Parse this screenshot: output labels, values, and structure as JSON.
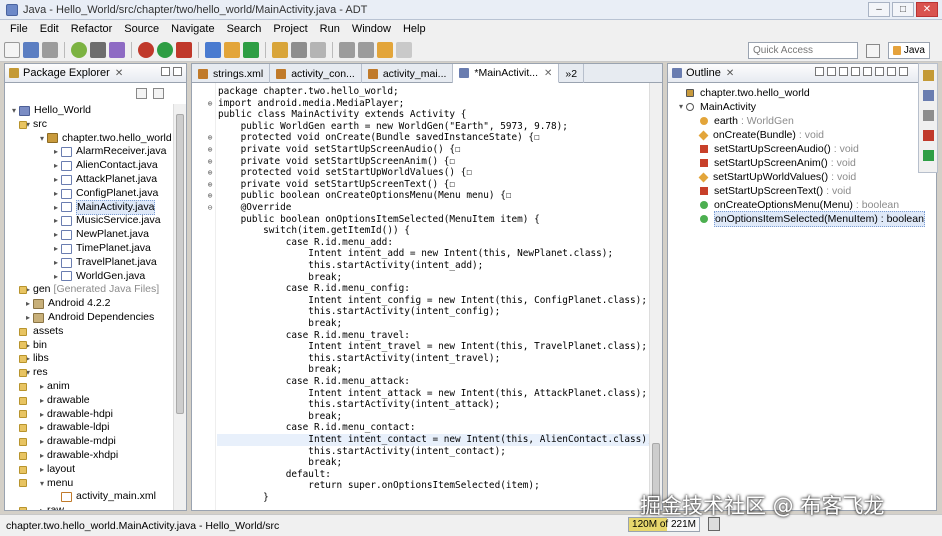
{
  "window": {
    "title": "Java - Hello_World/src/chapter/two/hello_world/MainActivity.java - ADT"
  },
  "menu": [
    "File",
    "Edit",
    "Refactor",
    "Source",
    "Navigate",
    "Search",
    "Project",
    "Run",
    "Window",
    "Help"
  ],
  "toolbar": {
    "quick_access": "Quick Access",
    "perspective": "Java"
  },
  "package_explorer": {
    "title": "Package Explorer",
    "rows": [
      {
        "depth": 0,
        "arrow": "▾",
        "icon": "proj",
        "label": "Hello_World"
      },
      {
        "depth": 1,
        "arrow": "▾",
        "icon": "fold",
        "label": "src"
      },
      {
        "depth": 2,
        "arrow": "▾",
        "icon": "pkg",
        "label": "chapter.two.hello_world"
      },
      {
        "depth": 3,
        "arrow": "▸",
        "icon": "java",
        "label": "AlarmReceiver.java"
      },
      {
        "depth": 3,
        "arrow": "▸",
        "icon": "java",
        "label": "AlienContact.java"
      },
      {
        "depth": 3,
        "arrow": "▸",
        "icon": "java",
        "label": "AttackPlanet.java"
      },
      {
        "depth": 3,
        "arrow": "▸",
        "icon": "java",
        "label": "ConfigPlanet.java"
      },
      {
        "depth": 3,
        "arrow": "▸",
        "icon": "java",
        "label": "MainActivity.java",
        "selected": true
      },
      {
        "depth": 3,
        "arrow": "▸",
        "icon": "java",
        "label": "MusicService.java"
      },
      {
        "depth": 3,
        "arrow": "▸",
        "icon": "java",
        "label": "NewPlanet.java"
      },
      {
        "depth": 3,
        "arrow": "▸",
        "icon": "java",
        "label": "TimePlanet.java"
      },
      {
        "depth": 3,
        "arrow": "▸",
        "icon": "java",
        "label": "TravelPlanet.java"
      },
      {
        "depth": 3,
        "arrow": "▸",
        "icon": "java",
        "label": "WorldGen.java"
      },
      {
        "depth": 1,
        "arrow": "▸",
        "icon": "fold",
        "label": "gen",
        "extra": "[Generated Java Files]"
      },
      {
        "depth": 1,
        "arrow": "▸",
        "icon": "lib",
        "label": "Android 4.2.2"
      },
      {
        "depth": 1,
        "arrow": "▸",
        "icon": "lib",
        "label": "Android Dependencies"
      },
      {
        "depth": 1,
        "arrow": "",
        "icon": "fold",
        "label": "assets"
      },
      {
        "depth": 1,
        "arrow": "▸",
        "icon": "fold",
        "label": "bin"
      },
      {
        "depth": 1,
        "arrow": "▸",
        "icon": "fold",
        "label": "libs"
      },
      {
        "depth": 1,
        "arrow": "▾",
        "icon": "fold",
        "label": "res"
      },
      {
        "depth": 2,
        "arrow": "▸",
        "icon": "fold",
        "label": "anim"
      },
      {
        "depth": 2,
        "arrow": "▸",
        "icon": "fold",
        "label": "drawable"
      },
      {
        "depth": 2,
        "arrow": "▸",
        "icon": "fold",
        "label": "drawable-hdpi"
      },
      {
        "depth": 2,
        "arrow": "▸",
        "icon": "fold",
        "label": "drawable-ldpi"
      },
      {
        "depth": 2,
        "arrow": "▸",
        "icon": "fold",
        "label": "drawable-mdpi"
      },
      {
        "depth": 2,
        "arrow": "▸",
        "icon": "fold",
        "label": "drawable-xhdpi"
      },
      {
        "depth": 2,
        "arrow": "▸",
        "icon": "fold",
        "label": "layout"
      },
      {
        "depth": 2,
        "arrow": "▾",
        "icon": "fold",
        "label": "menu"
      },
      {
        "depth": 3,
        "arrow": "",
        "icon": "xml",
        "label": "activity_main.xml"
      },
      {
        "depth": 2,
        "arrow": "▸",
        "icon": "fold",
        "label": "raw"
      }
    ]
  },
  "editor": {
    "tabs": [
      {
        "label": "strings.xml",
        "icon_color": "#c07a2a"
      },
      {
        "label": "activity_con...",
        "icon_color": "#c07a2a"
      },
      {
        "label": "activity_mai...",
        "icon_color": "#c07a2a"
      },
      {
        "label": "*MainActivit...",
        "icon_color": "#6a7db0",
        "active": true
      },
      {
        "label": "»2",
        "icon_color": ""
      }
    ],
    "lines": [
      {
        "t": "package chapter.two.hello_world;"
      },
      {
        "t": "import android.media.MediaPlayer;",
        "f": "+"
      },
      {
        "t": "public class MainActivity extends Activity {"
      },
      {
        "t": "    public WorldGen earth = new WorldGen(\"Earth\", 5973, 9.78);"
      },
      {
        "t": "    protected void onCreate(Bundle savedInstanceState) {☐",
        "f": "+"
      },
      {
        "t": "    private void setStartUpScreenAudio() {☐",
        "f": "+"
      },
      {
        "t": "    private void setStartUpScreenAnim() {☐",
        "f": "+"
      },
      {
        "t": "    protected void setStartUpWorldValues() {☐",
        "f": "+"
      },
      {
        "t": "    private void setStartUpScreenText() {☐",
        "f": "+"
      },
      {
        "t": "    public boolean onCreateOptionsMenu(Menu menu) {☐",
        "f": "+"
      },
      {
        "t": "    @Override",
        "f": "-"
      },
      {
        "t": "    public boolean onOptionsItemSelected(MenuItem item) {"
      },
      {
        "t": "        switch(item.getItemId()) {"
      },
      {
        "t": "            case R.id.menu_add:"
      },
      {
        "t": "                Intent intent_add = new Intent(this, NewPlanet.class);"
      },
      {
        "t": "                this.startActivity(intent_add);"
      },
      {
        "t": "                break;"
      },
      {
        "t": "            case R.id.menu_config:"
      },
      {
        "t": "                Intent intent_config = new Intent(this, ConfigPlanet.class);"
      },
      {
        "t": "                this.startActivity(intent_config);"
      },
      {
        "t": "                break;"
      },
      {
        "t": "            case R.id.menu_travel:"
      },
      {
        "t": "                Intent intent_travel = new Intent(this, TravelPlanet.class);"
      },
      {
        "t": "                this.startActivity(intent_travel);"
      },
      {
        "t": "                break;"
      },
      {
        "t": "            case R.id.menu_attack:"
      },
      {
        "t": "                Intent intent_attack = new Intent(this, AttackPlanet.class);"
      },
      {
        "t": "                this.startActivity(intent_attack);"
      },
      {
        "t": "                break;"
      },
      {
        "t": "            case R.id.menu_contact:"
      },
      {
        "t": "                Intent intent_contact = new Intent(this, AlienContact.class);",
        "hl": true
      },
      {
        "t": "                this.startActivity(intent_contact);"
      },
      {
        "t": "                break;"
      },
      {
        "t": "            default:"
      },
      {
        "t": "                return super.onOptionsItemSelected(item);"
      },
      {
        "t": "        }"
      }
    ]
  },
  "outline": {
    "title": "Outline",
    "rows": [
      {
        "depth": 0,
        "icon": "pkgimp",
        "label": "chapter.two.hello_world",
        "ret": ""
      },
      {
        "depth": 0,
        "icon": "class",
        "label": "MainActivity",
        "ret": "",
        "arrow": "▾"
      },
      {
        "depth": 1,
        "icon": "field",
        "label": "earth",
        "ret": ": WorldGen"
      },
      {
        "depth": 1,
        "icon": "prot",
        "label": "onCreate(Bundle)",
        "ret": ": void"
      },
      {
        "depth": 1,
        "icon": "priv",
        "label": "setStartUpScreenAudio()",
        "ret": ": void"
      },
      {
        "depth": 1,
        "icon": "priv",
        "label": "setStartUpScreenAnim()",
        "ret": ": void"
      },
      {
        "depth": 1,
        "icon": "prot",
        "label": "setStartUpWorldValues()",
        "ret": ": void"
      },
      {
        "depth": 1,
        "icon": "priv",
        "label": "setStartUpScreenText()",
        "ret": ": void"
      },
      {
        "depth": 1,
        "icon": "pub",
        "label": "onCreateOptionsMenu(Menu)",
        "ret": ": boolean"
      },
      {
        "depth": 1,
        "icon": "pub",
        "label": "onOptionsItemSelected(MenuItem) : boolean",
        "ret": "",
        "selected": true
      }
    ]
  },
  "status": {
    "text": "chapter.two.hello_world.MainActivity.java - Hello_World/src",
    "memory": "120M of 221M",
    "memory_fraction": 0.54
  },
  "watermark": "掘金技术社区 @ 布客飞龙"
}
